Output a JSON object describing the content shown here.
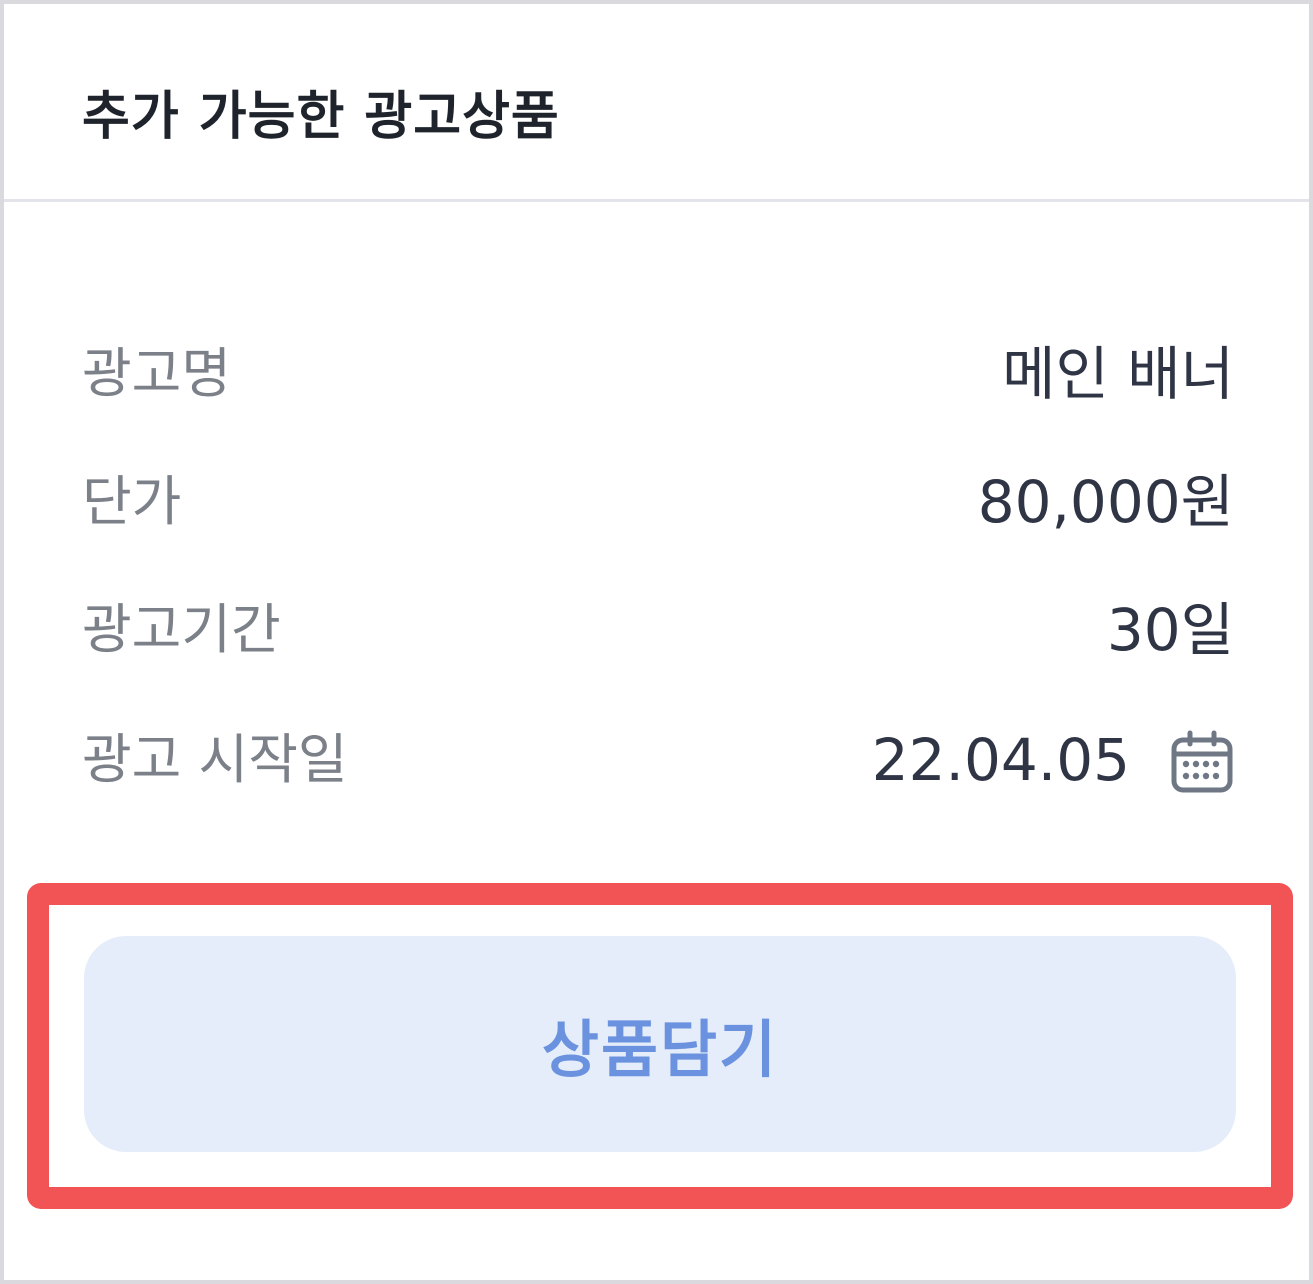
{
  "header": {
    "title": "추가 가능한 광고상품"
  },
  "details": [
    {
      "label": "광고명",
      "value": "메인 배너"
    },
    {
      "label": "단가",
      "value": "80,000원"
    },
    {
      "label": "광고기간",
      "value": "30일"
    },
    {
      "label": "광고 시작일",
      "value": "22.04.05",
      "icon": "calendar-icon"
    }
  ],
  "action": {
    "add_label": "상품담기"
  },
  "colors": {
    "highlight": "#f25456",
    "button_bg": "#e5edfb",
    "button_text": "#6b92de"
  }
}
